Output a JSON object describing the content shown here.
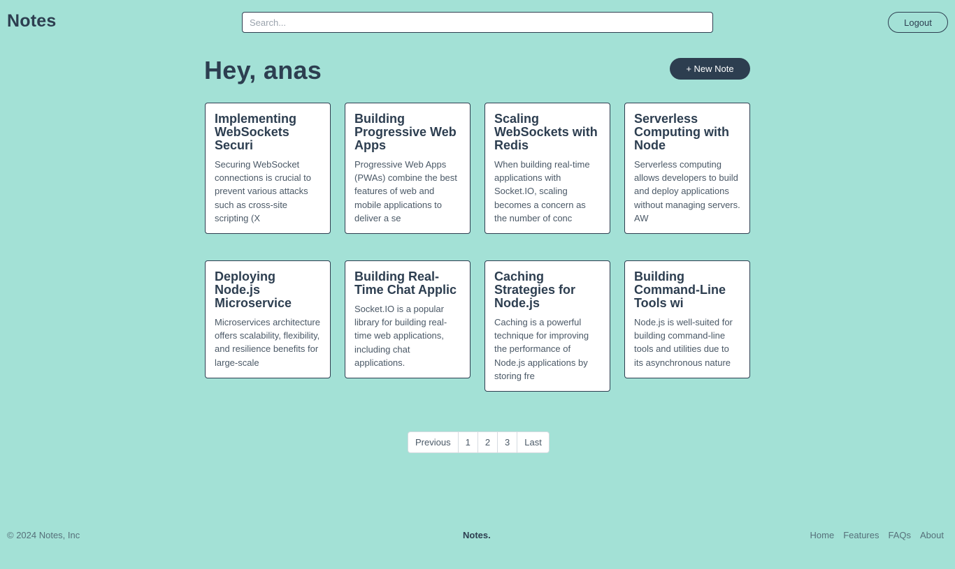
{
  "header": {
    "brand": "Notes",
    "search_placeholder": "Search...",
    "logout_label": "Logout"
  },
  "main": {
    "greeting": "Hey, anas",
    "new_note_label": "+ New Note",
    "notes": [
      {
        "title": "Implementing WebSockets Securi",
        "body": "Securing WebSocket connections is crucial to prevent various attacks such as cross-site scripting (X"
      },
      {
        "title": "Building Progressive Web Apps",
        "body": "Progressive Web Apps (PWAs) combine the best features of web and mobile applications to deliver a se"
      },
      {
        "title": "Scaling WebSockets with Redis",
        "body": "When building real-time applications with Socket.IO, scaling becomes a concern as the number of conc"
      },
      {
        "title": "Serverless Computing with Node",
        "body": "Serverless computing allows developers to build and deploy applications without managing servers. AW"
      },
      {
        "title": "Deploying Node.js Microservice",
        "body": "Microservices architecture offers scalability, flexibility, and resilience benefits for large-scale"
      },
      {
        "title": "Building Real-Time Chat Applic",
        "body": "Socket.IO is a popular library for building real-time web applications, including chat applications."
      },
      {
        "title": "Caching Strategies for Node.js",
        "body": "Caching is a powerful technique for improving the performance of Node.js applications by storing fre"
      },
      {
        "title": "Building Command-Line Tools wi",
        "body": "Node.js is well-suited for building command-line tools and utilities due to its asynchronous nature"
      }
    ]
  },
  "pagination": {
    "previous": "Previous",
    "pages": [
      "1",
      "2",
      "3"
    ],
    "last": "Last"
  },
  "footer": {
    "copyright": "© 2024 Notes, Inc",
    "brand": "Notes.",
    "links": [
      "Home",
      "Features",
      "FAQs",
      "About"
    ]
  }
}
